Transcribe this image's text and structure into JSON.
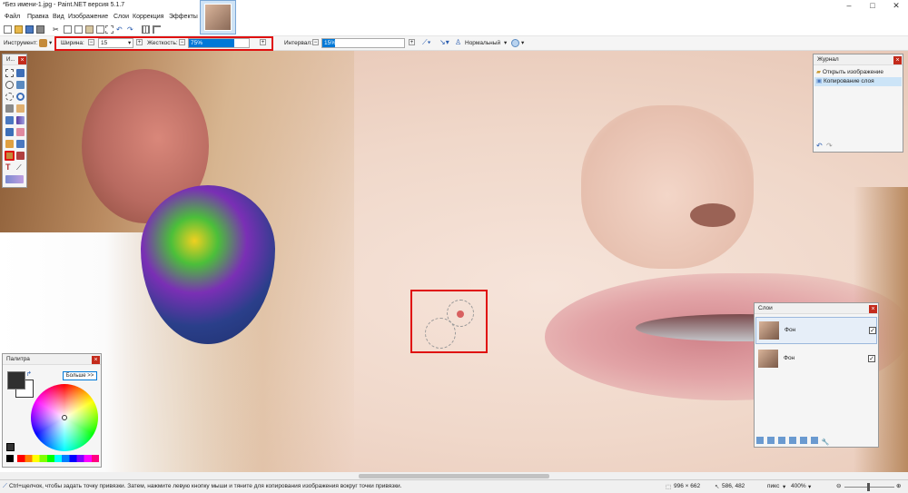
{
  "window": {
    "title": "*Без имени-1.jpg - Paint.NET версия 5.1.7"
  },
  "menu": [
    "Файл",
    "Правка",
    "Вид",
    "Изображение",
    "Слои",
    "Коррекция",
    "Эффекты"
  ],
  "toolbar": {
    "tool_label": "Инструмент:",
    "width_label": "Ширина:",
    "width_value": "15",
    "hardness_label": "Жесткость:",
    "hardness_value": "75%",
    "interval_label": "Интервал:",
    "interval_value": "15%",
    "blend_mode": "Нормальный"
  },
  "tools_panel": {
    "title": "И..."
  },
  "palette": {
    "title": "Палитра",
    "more_button": "Больше >>"
  },
  "history": {
    "title": "Журнал",
    "items": [
      "Открыть изображение",
      "Копирование слоя"
    ]
  },
  "layers": {
    "title": "Слои",
    "items": [
      "Фон",
      "Фон"
    ]
  },
  "status": {
    "hint": "Ctrl+щелчок, чтобы задать точку привязки. Затем, нажмите левую кнопку мыши и тяните для копирования изображения вокруг точки привязки.",
    "image_size": "996 × 662",
    "cursor_pos": "586, 482",
    "units": "пикс",
    "zoom": "400%"
  },
  "colors": {
    "accent": "#0078d7",
    "highlight": "#e01010"
  }
}
